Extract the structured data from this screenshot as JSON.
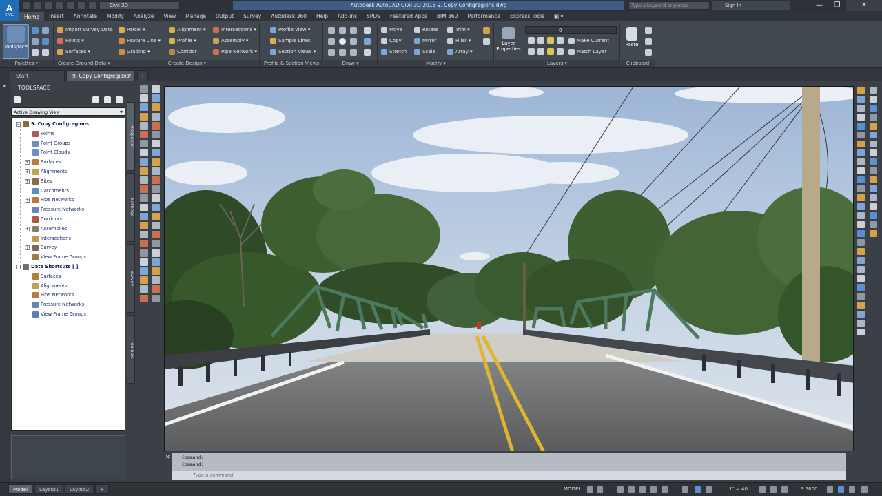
{
  "app": {
    "logo_letter": "A",
    "logo_sub": "CIVIL",
    "workspace": "Civil 3D",
    "title": "Autodesk AutoCAD Civil 3D 2016    9. Copy Configregions.dwg",
    "help_search_placeholder": "Type a keyword or phrase",
    "signin_label": "Sign In",
    "window_controls": [
      "—",
      "❐",
      "✕"
    ]
  },
  "ribbon_tabs": [
    "Home",
    "Insert",
    "Annotate",
    "Modify",
    "Analyze",
    "View",
    "Manage",
    "Output",
    "Survey",
    "Autodesk 360",
    "Help",
    "Add-ins",
    "SPDS",
    "Featured Apps",
    "BIM 360",
    "Performance",
    "Express Tools",
    "▣ ▾"
  ],
  "active_tab": "Home",
  "ribbon": {
    "palettes": {
      "title": "Palettes ▾",
      "toolspace_label": "Toolspace"
    },
    "create_ground_data": {
      "title": "Create Ground Data ▾",
      "buttons": [
        "Import Survey Data",
        "Points ▾",
        "Surfaces ▾"
      ]
    },
    "create_design": {
      "title": "Create Design ▾",
      "buttons": [
        "Parcel ▾",
        "Feature Line ▾",
        "Grading ▾",
        "Alignment ▾",
        "Profile ▾",
        "Corridor",
        "Intersections ▾",
        "Assembly ▾",
        "Pipe Network ▾"
      ]
    },
    "profile_section": {
      "title": "Profile & Section Views",
      "buttons": [
        "Profile View ▾",
        "Sample Lines",
        "Section Views ▾"
      ]
    },
    "draw": {
      "title": "Draw ▾"
    },
    "modify": {
      "title": "Modify ▾",
      "buttons": [
        "Move",
        "Copy",
        "Stretch",
        "Rotate",
        "Mirror",
        "Scale",
        "Trim ▾",
        "Fillet ▾",
        "Array ▾"
      ]
    },
    "layers": {
      "title": "Layers ▾",
      "layer_value": "0",
      "layer_properties_label": "Layer Properties",
      "buttons": [
        "Make Current",
        "Match Layer"
      ]
    },
    "clipboard": {
      "title": "Clipboard",
      "paste_label": "Paste"
    }
  },
  "doc_tabs": [
    "Start",
    "9. Copy Configregions"
  ],
  "doc_tab_close": "✕",
  "doc_tab_add": "+",
  "toolspace": {
    "title": "TOOLSPACE",
    "view_select": "Active Drawing View",
    "vertical_tabs": [
      "Prospector",
      "Settings",
      "Survey",
      "Toolbox"
    ],
    "tree": [
      {
        "label": "9. Copy Configregions",
        "root": true
      },
      {
        "label": "Points"
      },
      {
        "label": "Point Groups"
      },
      {
        "label": "Point Clouds"
      },
      {
        "label": "Surfaces"
      },
      {
        "label": "Alignments"
      },
      {
        "label": "Sites"
      },
      {
        "label": "Catchments"
      },
      {
        "label": "Pipe Networks"
      },
      {
        "label": "Pressure Networks"
      },
      {
        "label": "Corridors"
      },
      {
        "label": "Assemblies"
      },
      {
        "label": "Intersections"
      },
      {
        "label": "Survey"
      },
      {
        "label": "View Frame Groups"
      },
      {
        "label": "Data Shortcuts [ ]",
        "root": true
      },
      {
        "label": "Surfaces"
      },
      {
        "label": "Alignments"
      },
      {
        "label": "Pipe Networks"
      },
      {
        "label": "Pressure Networks"
      },
      {
        "label": "View Frame Groups"
      }
    ]
  },
  "command_line": {
    "history": [
      "Command:",
      "Command:"
    ],
    "placeholder": "Type a command",
    "close_icon": "✕"
  },
  "layout_tabs": [
    "Model",
    "Layout1",
    "Layout2"
  ],
  "layout_add": "+",
  "status": {
    "model_label": "MODEL",
    "angle": "1\" = 40'",
    "scale": "3.5000"
  },
  "colors": {
    "accent": "#1f6fb7",
    "ribbon_bg": "#42484f",
    "tree_bg": "#ffffff",
    "sky": "#a9bfd9",
    "bridge_green": "#4d7a5e",
    "road_line_yellow": "#e2b531"
  }
}
